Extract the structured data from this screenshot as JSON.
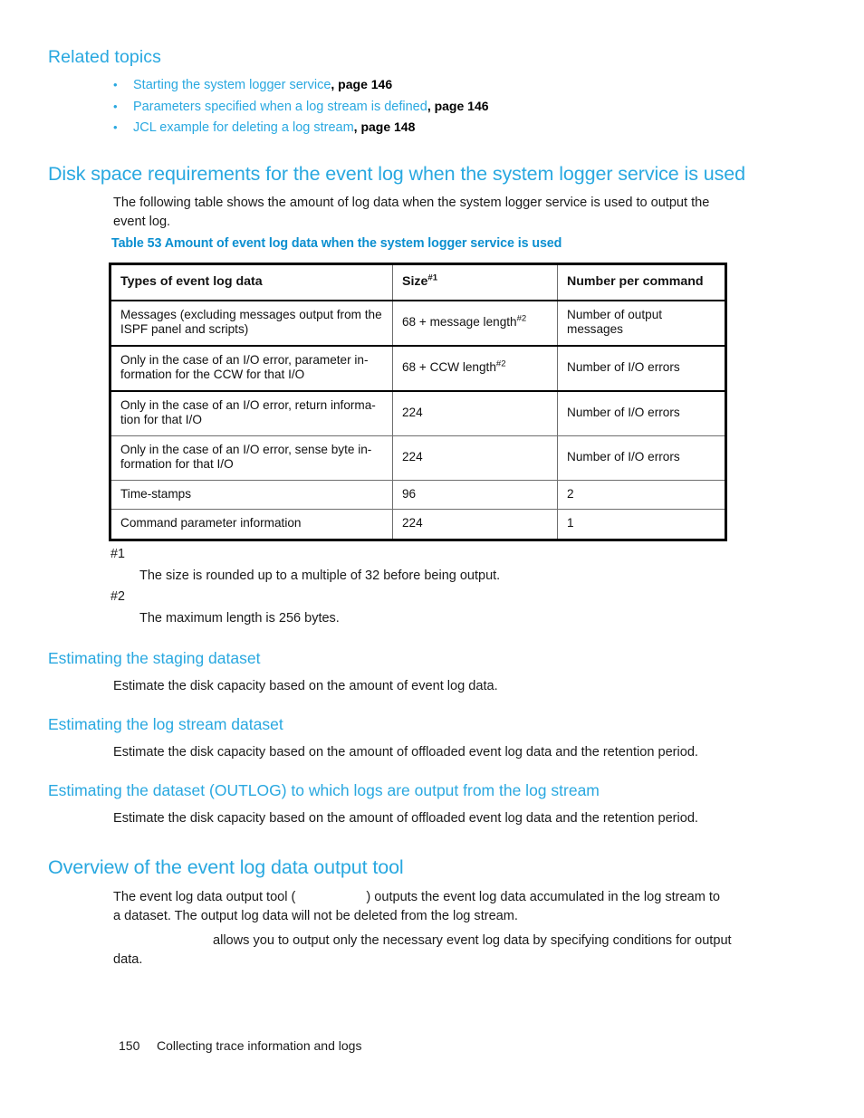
{
  "colors": {
    "heading_blue": "#29a8e0",
    "caption_blue": "#0b8fd0",
    "link_blue": "#29a8e0",
    "body_black": "#1a1a1a"
  },
  "related_topics": {
    "heading": "Related topics",
    "bullet_glyph": "•",
    "items": [
      {
        "link": "Starting the system logger service",
        "suffix": ", page 146"
      },
      {
        "link": "Parameters specified when a log stream is defined",
        "suffix": ", page 146"
      },
      {
        "link": "JCL example for deleting a log stream",
        "suffix": ", page 148"
      }
    ]
  },
  "disk_space_section": {
    "heading": "Disk space requirements for the event log when the system logger service is used",
    "intro": "The following table shows the amount of log data when the system logger service is used to output the event log."
  },
  "table": {
    "caption": "Table 53 Amount of event log data when the system logger service is used",
    "headers": {
      "type": "Types of event log data",
      "size": "Size",
      "size_sup": "#1",
      "number": "Number per command"
    },
    "rows": [
      {
        "type": "Messages (excluding messages output from the ISPF panel and scripts)",
        "size": "68 + message length",
        "size_sup": "#2",
        "number": "Number of output messages"
      },
      {
        "type": "Only in the case of an I/O error, parameter in-formation for the CCW for that I/O",
        "size": "68 + CCW length",
        "size_sup": "#2",
        "number": "Number of I/O errors"
      },
      {
        "type": "Only in the case of an I/O error, return informa-tion for that I/O",
        "size": "224",
        "size_sup": "",
        "number": "Number of I/O errors"
      },
      {
        "type": "Only in the case of an I/O error, sense byte in-formation for that I/O",
        "size": "224",
        "size_sup": "",
        "number": "Number of I/O errors"
      },
      {
        "type": "Time-stamps",
        "size": "96",
        "size_sup": "",
        "number": "2"
      },
      {
        "type": "Command parameter information",
        "size": "224",
        "size_sup": "",
        "number": "1"
      }
    ]
  },
  "footnotes": [
    {
      "key": "#1",
      "text": "The size is rounded up to a multiple of 32 before being output."
    },
    {
      "key": "#2",
      "text": "The maximum length is 256 bytes."
    }
  ],
  "estimating_staging": {
    "heading": "Estimating the staging dataset",
    "body": "Estimate the disk capacity based on the amount of event log data."
  },
  "estimating_logstream": {
    "heading": "Estimating the log stream dataset",
    "body": "Estimate the disk capacity based on the amount of offloaded event log data and the retention period."
  },
  "estimating_outlog": {
    "heading": "Estimating the dataset (OUTLOG) to which logs are output from the log stream",
    "body": "Estimate the disk capacity based on the amount of offloaded event log data and the retention period."
  },
  "overview_section": {
    "heading": "Overview of the event log data output tool",
    "para1_before": "The event log data output tool (",
    "para1_after": ") outputs the event log data accumulated in the log stream to a dataset. The output log data will not be deleted from the log stream.",
    "para2_after": "allows you to output only the necessary event log data by specifying conditions for output data."
  },
  "footer": {
    "page_number": "150",
    "chapter": "Collecting trace information and logs"
  }
}
